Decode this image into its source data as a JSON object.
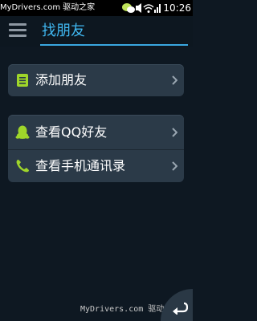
{
  "status_bar": {
    "site_text": "MyDrivers.com",
    "site_name": "驱动之家",
    "time": "10:26",
    "icons": [
      "wechat-icon",
      "mute-icon",
      "wifi-icon",
      "signal-icon",
      "battery-icon"
    ]
  },
  "header": {
    "title": "找朋友",
    "accent": "#3fb6ef"
  },
  "groups": [
    {
      "items": [
        {
          "label": "添加朋友",
          "icon": "contacts-book-icon",
          "color": "#9fd62a"
        }
      ]
    },
    {
      "items": [
        {
          "label": "查看QQ好友",
          "icon": "qq-penguin-icon",
          "color": "#9fd62a"
        },
        {
          "label": "查看手机通讯录",
          "icon": "phone-icon",
          "color": "#9fd62a"
        }
      ]
    }
  ],
  "footer": {
    "watermark": "MyDrivers.com 驱动之家",
    "back_icon": "back-arrow-icon"
  }
}
